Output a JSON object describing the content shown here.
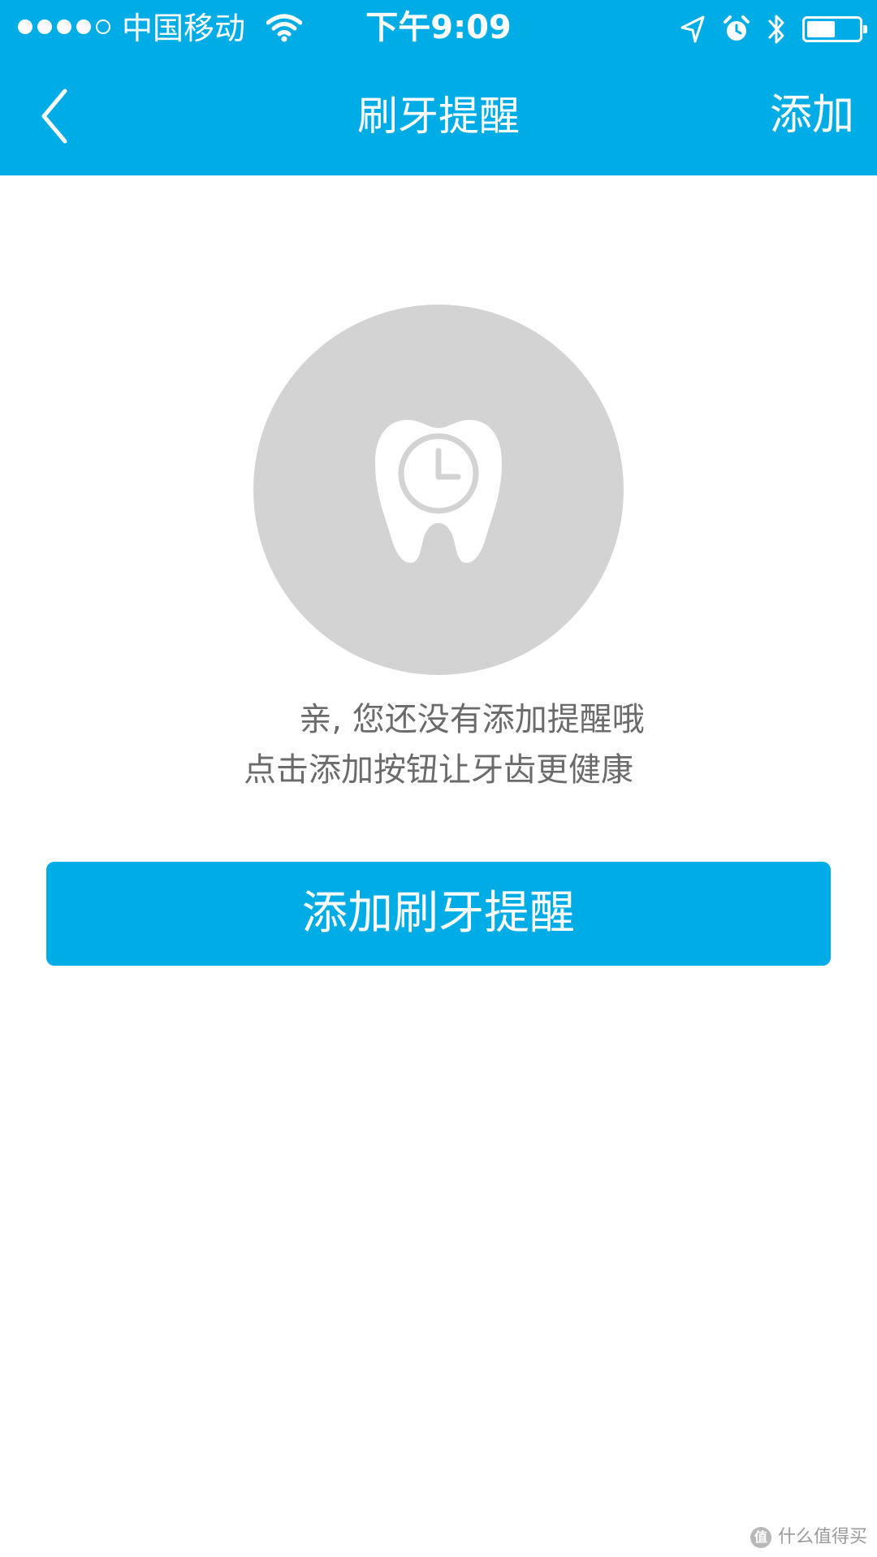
{
  "status_bar": {
    "carrier": "中国移动",
    "time": "下午9:09",
    "battery_level": 0.55,
    "icons": [
      "signal-dots-icon",
      "wifi-icon",
      "location-arrow-icon",
      "alarm-icon",
      "bluetooth-icon",
      "battery-icon"
    ]
  },
  "nav": {
    "title": "刷牙提醒",
    "right_action": "添加",
    "back_icon": "chevron-left-icon"
  },
  "empty_state": {
    "icon": "tooth-clock-icon",
    "line1": "亲, 您还没有添加提醒哦",
    "line2": "点击添加按钮让牙齿更健康"
  },
  "primary_button": {
    "label": "添加刷牙提醒"
  },
  "watermark": {
    "badge": "值",
    "text": "什么值得买"
  },
  "colors": {
    "brand": "#00ace6",
    "circle": "#d3d3d3",
    "body_text": "#6b6b6b"
  }
}
